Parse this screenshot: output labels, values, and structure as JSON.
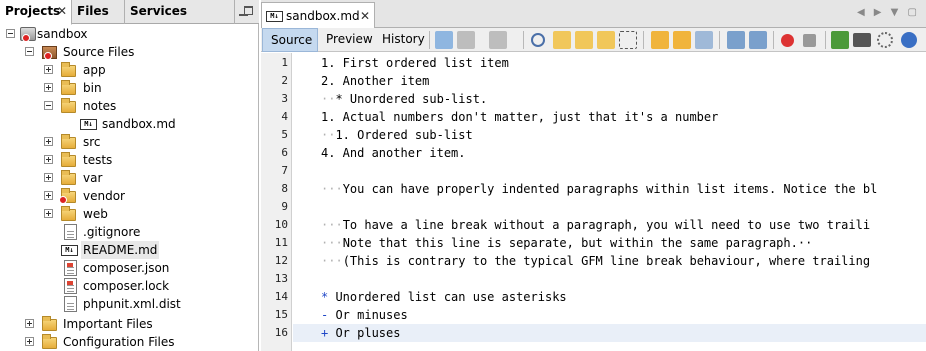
{
  "left_panel": {
    "tabs": [
      {
        "label": "Projects",
        "close": "✕"
      },
      {
        "label": "Files"
      },
      {
        "label": "Services"
      }
    ],
    "tree": {
      "project": "sandbox",
      "source_files": "Source Files",
      "items": [
        {
          "label": "app"
        },
        {
          "label": "bin"
        },
        {
          "label": "notes"
        },
        {
          "label": "sandbox.md"
        },
        {
          "label": "src"
        },
        {
          "label": "tests"
        },
        {
          "label": "var"
        },
        {
          "label": "vendor"
        },
        {
          "label": "web"
        },
        {
          "label": ".gitignore"
        },
        {
          "label": "README.md"
        },
        {
          "label": "composer.json"
        },
        {
          "label": "composer.lock"
        },
        {
          "label": "phpunit.xml.dist"
        }
      ],
      "important_files": "Important Files",
      "configuration_files": "Configuration Files"
    }
  },
  "editor": {
    "tab": {
      "title": "sandbox.md",
      "close": "✕",
      "icon_text": "M↓"
    },
    "nav_arrows": "◀ ▶ ▼ ▢",
    "toolbar": {
      "source": "Source",
      "preview": "Preview",
      "history": "History"
    },
    "lines": [
      {
        "n": "1",
        "ws": "",
        "mark": "",
        "text": "1. First ordered list item"
      },
      {
        "n": "2",
        "ws": "",
        "mark": "",
        "text": "2. Another item"
      },
      {
        "n": "3",
        "ws": "··",
        "mark": "",
        "text": "* Unordered sub-list."
      },
      {
        "n": "4",
        "ws": "",
        "mark": "",
        "text": "1. Actual numbers don't matter, just that it's a number"
      },
      {
        "n": "5",
        "ws": "··",
        "mark": "",
        "text": "1. Ordered sub-list"
      },
      {
        "n": "6",
        "ws": "",
        "mark": "",
        "text": "4. And another item."
      },
      {
        "n": "7",
        "ws": "",
        "mark": "",
        "text": ""
      },
      {
        "n": "8",
        "ws": "···",
        "mark": "",
        "text": "You can have properly indented paragraphs within list items. Notice the bl"
      },
      {
        "n": "9",
        "ws": "",
        "mark": "",
        "text": ""
      },
      {
        "n": "10",
        "ws": "···",
        "mark": "",
        "text": "To have a line break without a paragraph, you will need to use two traili"
      },
      {
        "n": "11",
        "ws": "···",
        "mark": "",
        "text": "Note that this line is separate, but within the same paragraph.··"
      },
      {
        "n": "12",
        "ws": "···",
        "mark": "",
        "text": "(This is contrary to the typical GFM line break behaviour, where trailing"
      },
      {
        "n": "13",
        "ws": "",
        "mark": "",
        "text": ""
      },
      {
        "n": "14",
        "ws": "",
        "mark": "*",
        "text": " Unordered list can use asterisks"
      },
      {
        "n": "15",
        "ws": "",
        "mark": "-",
        "text": " Or minuses"
      },
      {
        "n": "16",
        "ws": "",
        "mark": "+",
        "text": " Or pluses"
      }
    ],
    "current_line": 16
  },
  "colors": {
    "accent": "#c5d9ef",
    "list_marker": "#1f47c7",
    "spellcheck": "#d22222"
  }
}
